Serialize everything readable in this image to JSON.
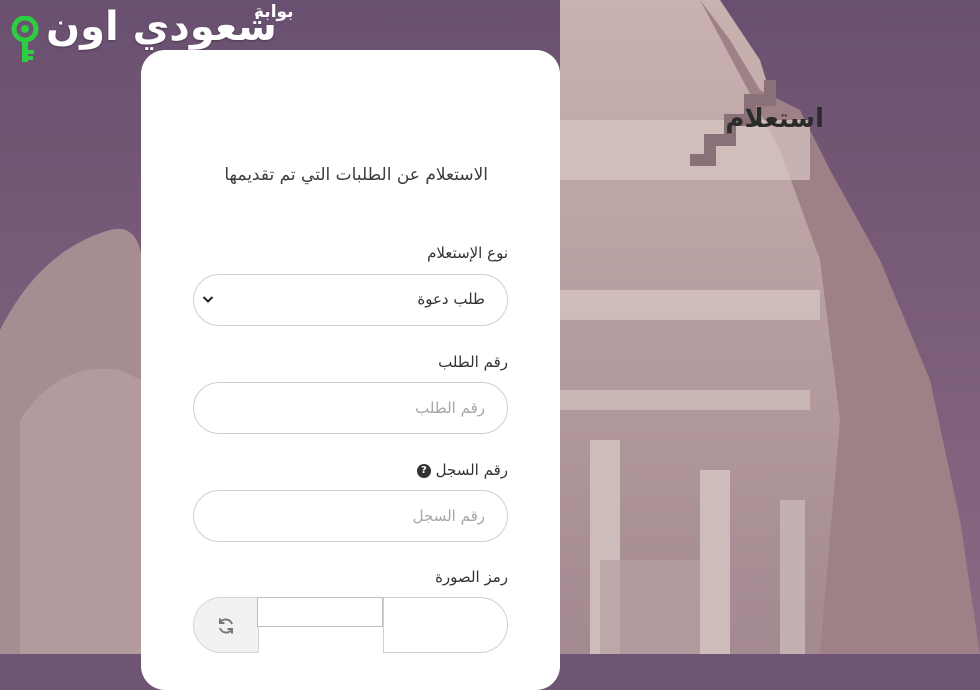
{
  "logo": {
    "main": "شعودي اون",
    "sub": "بوابة"
  },
  "form": {
    "title": "استعلام",
    "description": "الاستعلام عن الطلبات التي تم تقديمها",
    "inquiry_type": {
      "label": "نوع الإستعلام",
      "value": "طلب دعوة"
    },
    "request_number": {
      "label": "رقم الطلب",
      "placeholder": "رقم الطلب"
    },
    "registry_number": {
      "label": "رقم السجل",
      "placeholder": "رقم السجل",
      "help_icon": "?"
    },
    "captcha": {
      "label": "رمز الصورة",
      "refresh_icon": "refresh-icon"
    }
  },
  "colors": {
    "background": "#6e5574",
    "logo_key": "#2ecc40",
    "card": "#ffffff"
  }
}
